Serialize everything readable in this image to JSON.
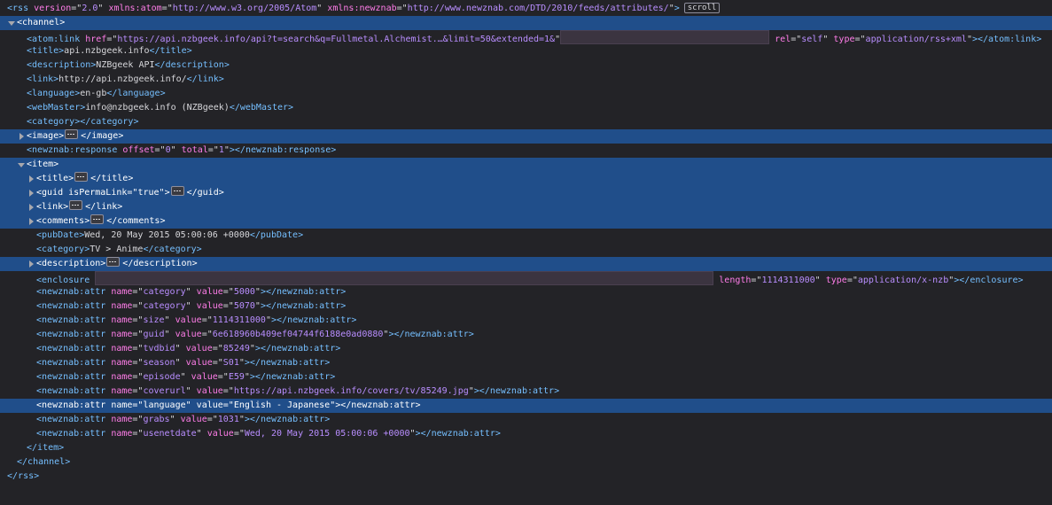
{
  "rss_open": {
    "tag": "rss",
    "attrs": [
      {
        "n": "version",
        "v": "2.0"
      },
      {
        "n": "xmlns:atom",
        "v": "http://www.w3.org/2005/Atom"
      },
      {
        "n": "xmlns:newznab",
        "v": "http://www.newznab.com/DTD/2010/feeds/attributes/"
      }
    ],
    "badge": "scroll"
  },
  "channel": {
    "tag": "channel",
    "atom_link": {
      "tag": "atom:link",
      "attrs": [
        {
          "n": "href",
          "v": "https://api.nzbgeek.info/api?t=search&q=Fullmetal.Alchemist.…&limit=50&extended=1&"
        }
      ],
      "attrs_after": [
        {
          "n": "rel",
          "v": "self"
        },
        {
          "n": "type",
          "v": "application/rss+xml"
        }
      ]
    },
    "title": "api.nzbgeek.info",
    "description": "NZBgeek API",
    "link": "http://api.nzbgeek.info/",
    "language": "en-gb",
    "webMaster": "info@nzbgeek.info (NZBgeek)",
    "category": "",
    "image_tag": "image",
    "newznab_response": {
      "tag": "newznab:response",
      "attrs": [
        {
          "n": "offset",
          "v": "0"
        },
        {
          "n": "total",
          "v": "1"
        }
      ]
    }
  },
  "item": {
    "tag": "item",
    "title_tag": "title",
    "guid": {
      "tag": "guid",
      "attrs": [
        {
          "n": "isPermaLink",
          "v": "true"
        }
      ]
    },
    "link_tag": "link",
    "comments_tag": "comments",
    "pubDate": "Wed, 20 May 2015 05:00:06 +0000",
    "category": "TV > Anime",
    "description_tag": "description",
    "enclosure": {
      "tag": "enclosure",
      "attrs_after": [
        {
          "n": "length",
          "v": "1114311000"
        },
        {
          "n": "type",
          "v": "application/x-nzb"
        }
      ]
    },
    "attr_tag": "newznab:attr",
    "attrs": [
      {
        "name": "category",
        "value": "5000"
      },
      {
        "name": "category",
        "value": "5070"
      },
      {
        "name": "size",
        "value": "1114311000"
      },
      {
        "name": "guid",
        "value": "6e618960b409ef04744f6188e0ad0880"
      },
      {
        "name": "tvdbid",
        "value": "85249"
      },
      {
        "name": "season",
        "value": "S01"
      },
      {
        "name": "episode",
        "value": "E59"
      },
      {
        "name": "coverurl",
        "value": "https://api.nzbgeek.info/covers/tv/85249.jpg"
      },
      {
        "name": "language",
        "value": "English - Japanese"
      },
      {
        "name": "grabs",
        "value": "1031"
      },
      {
        "name": "usenetdate",
        "value": "Wed, 20 May 2015 05:00:06 +0000"
      }
    ],
    "selected_attr_index": 8
  },
  "colors": {
    "background": "#232327",
    "tag": "#75bfff",
    "attr_name": "#ff7de9",
    "attr_value": "#b98eff",
    "text": "#d7d7db",
    "selection": "#204e8a"
  }
}
